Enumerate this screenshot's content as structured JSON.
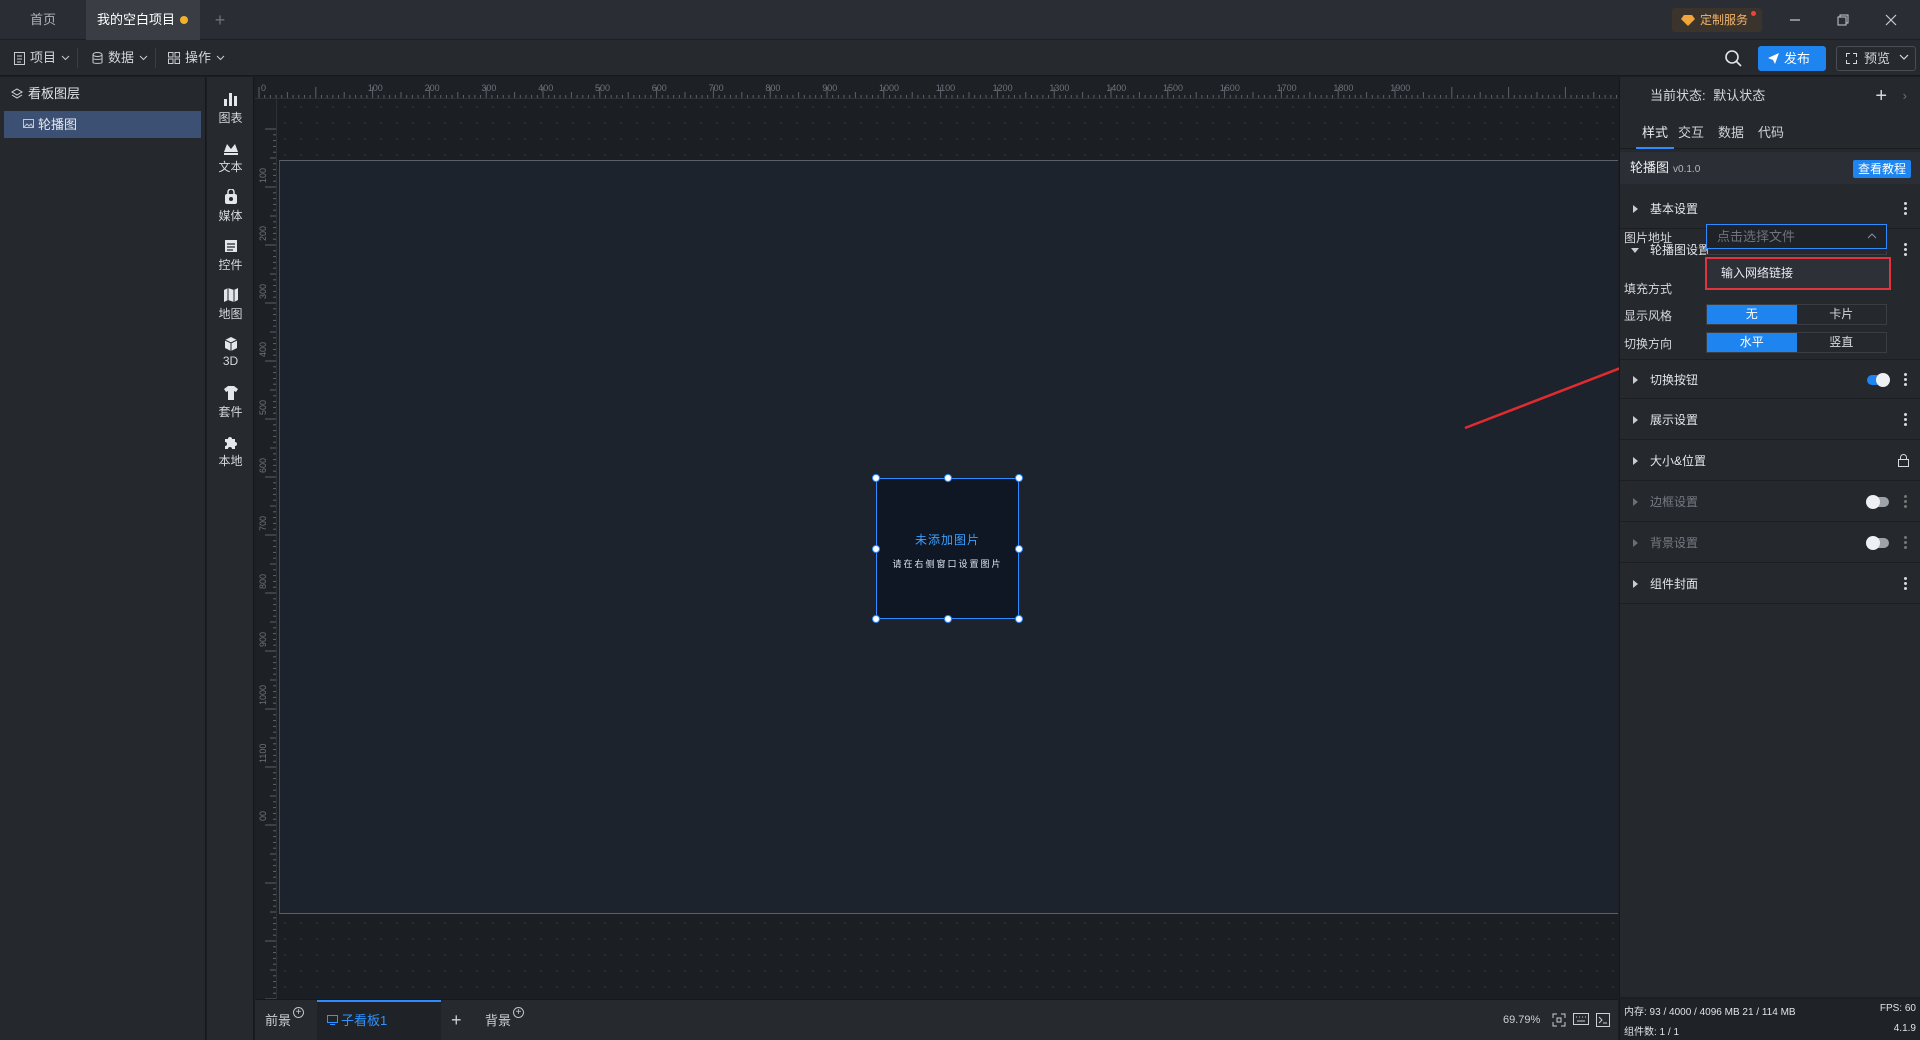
{
  "titlebar": {
    "tabs": [
      {
        "label": "首页"
      },
      {
        "label": "我的空白项目",
        "unsaved": true
      }
    ],
    "add_tab": "+",
    "custom_service": "定制服务"
  },
  "toolbar": {
    "menus": [
      {
        "label": "项目",
        "icon": "document-icon"
      },
      {
        "label": "数据",
        "icon": "database-icon"
      },
      {
        "label": "操作",
        "icon": "grid-icon"
      }
    ],
    "publish_label": "发布",
    "preview_label": "预览"
  },
  "layers": {
    "title": "看板图层",
    "items": [
      {
        "label": "轮播图",
        "selected": true
      }
    ]
  },
  "components": [
    {
      "label": "图表",
      "icon": "bar-chart-icon"
    },
    {
      "label": "文本",
      "icon": "text-icon"
    },
    {
      "label": "媒体",
      "icon": "media-icon"
    },
    {
      "label": "控件",
      "icon": "control-icon"
    },
    {
      "label": "地图",
      "icon": "map-icon"
    },
    {
      "label": "3D",
      "icon": "cube-icon"
    },
    {
      "label": "套件",
      "icon": "kit-icon"
    },
    {
      "label": "本地",
      "icon": "puzzle-icon"
    }
  ],
  "ruler": {
    "top_labels": [
      "0",
      "100",
      "200",
      "300",
      "400",
      "500",
      "600",
      "700",
      "800",
      "900",
      "1000",
      "1100",
      "1200",
      "1300",
      "1400",
      "1500",
      "1600",
      "1700",
      "1800",
      "1900"
    ],
    "left_labels": [
      "100",
      "200",
      "300",
      "400",
      "500",
      "600",
      "700",
      "800",
      "900",
      "1000",
      "1100",
      "00"
    ]
  },
  "canvas": {
    "carousel_title": "未添加图片",
    "carousel_subtitle": "请在右侧窗口设置图片"
  },
  "bottom": {
    "front_label": "前景",
    "sub_board_label": "子看板1",
    "add_label": "+",
    "back_label": "背景",
    "zoom": "69.79%"
  },
  "right_panel": {
    "state_label": "当前状态:",
    "state_value": "默认状态",
    "tabs": [
      {
        "label": "样式",
        "active": true
      },
      {
        "label": "交互"
      },
      {
        "label": "数据"
      },
      {
        "label": "代码"
      }
    ],
    "component_name": "轮播图",
    "component_version": "v0.1.0",
    "tutorial_label": "查看教程",
    "sections": {
      "basic": "基本设置",
      "carousel": "轮播图设置",
      "switch_button": "切换按钮",
      "display": "展示设置",
      "size_position": "大小&位置",
      "border": "边框设置",
      "background": "背景设置",
      "cover": "组件封面"
    },
    "image_url_label": "图片地址",
    "image_url_placeholder": "点击选择文件",
    "dropdown_option": "输入网络链接",
    "fill_label": "填充方式",
    "style_label": "显示风格",
    "style_options": [
      {
        "label": "无",
        "active": true
      },
      {
        "label": "卡片"
      }
    ],
    "direction_label": "切换方向",
    "direction_options": [
      {
        "label": "水平",
        "active": true
      },
      {
        "label": "竖直"
      }
    ],
    "switch_button_on": true,
    "border_on": false,
    "background_on": false
  },
  "status": {
    "memory": "内存: 93 / 4000 / 4096 MB  21 / 114 MB",
    "fps": "FPS: 60",
    "count": "组件数: 1 / 1",
    "version": "4.1.9"
  },
  "colors": {
    "accent": "#1d84f0",
    "highlight": "#e2343c",
    "unsaved_dot": "#f2b02e"
  }
}
